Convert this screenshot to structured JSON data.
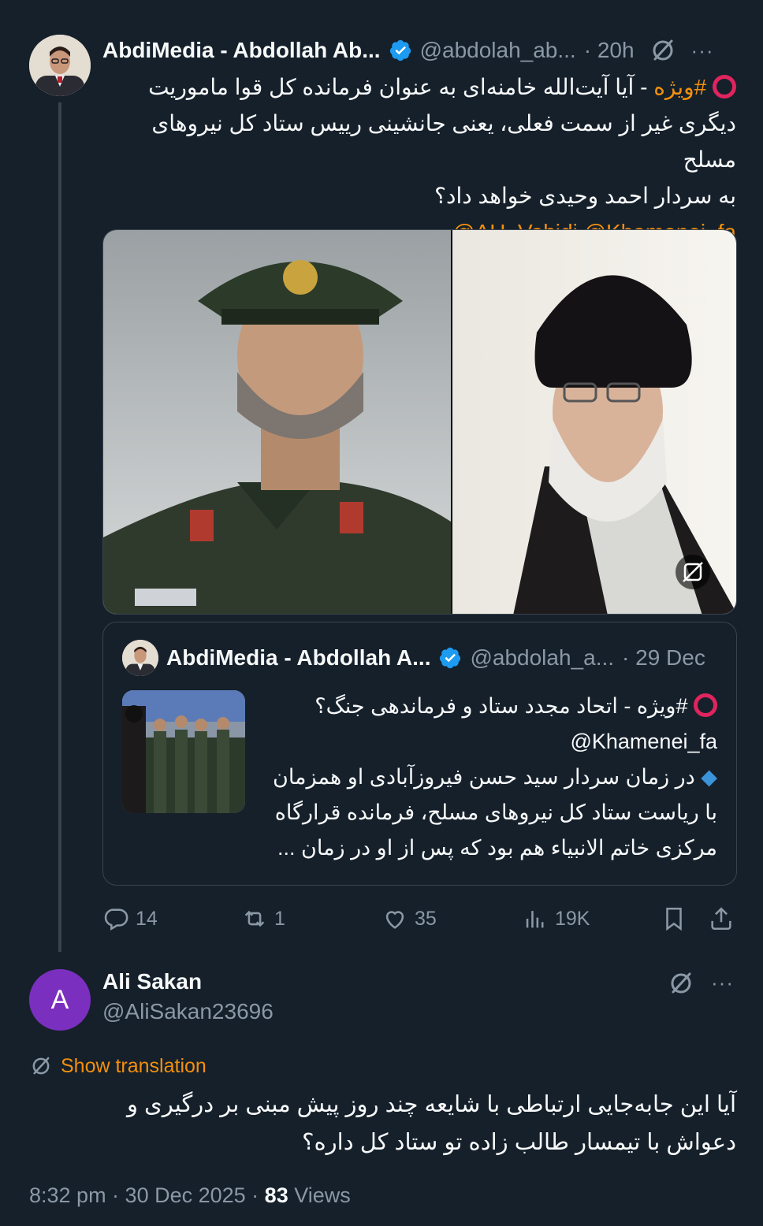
{
  "main_tweet": {
    "author_name": "AbdiMedia - Abdollah Ab...",
    "handle": "@abdolah_ab...",
    "time": "· 20h",
    "more": "···",
    "text_lines": {
      "hashtag": "#ویژه",
      "line1_rest": " - آیا آیت‌الله خامنه‌ای به عنوان فرمانده کل قوا ماموریت",
      "line2": "دیگری غیر از سمت فعلی، یعنی جانشینی رییس ستاد کل نیروهای مسلح",
      "line3": "به سردار احمد وحیدی خواهد داد؟",
      "mentions": "@AH_Vahidi @Khamenei_fa"
    }
  },
  "quote": {
    "author_name": "AbdiMedia - Abdollah A...",
    "handle": "@abdolah_a...",
    "date": "· 29 Dec",
    "line1": "#ویژه - اتحاد مجدد ستاد و فرماندهی جنگ؟",
    "mention": "@Khamenei_fa",
    "line2": "در زمان سردار سید حسن فیروزآبادی او همزمان",
    "line3": "با ریاست ستاد کل نیروهای مسلح، فرمانده قرارگاه",
    "line4": "مرکزی خاتم الانبیاء هم بود که پس از او در زمان ..."
  },
  "actions": {
    "replies": "14",
    "reposts": "1",
    "likes": "35",
    "views": "19K"
  },
  "reply": {
    "avatar_letter": "A",
    "name": "Ali Sakan",
    "handle": "@AliSakan23696",
    "more": "···",
    "show_translation": "Show translation",
    "line1": "آیا این جابه‌جایی ارتباطی با شایعه چند روز پیش مبنی بر درگیری و",
    "line2": "دعواش با تیمسار طالب زاده تو ستاد کل داره؟",
    "time": "8:32 pm · 30 Dec 2025 · ",
    "views_count": "83",
    "views_label": " Views"
  },
  "colors": {
    "background": "#15202b",
    "accent": "#f4900c",
    "verified": "#1d9bf0",
    "muted": "#8b98a5"
  }
}
